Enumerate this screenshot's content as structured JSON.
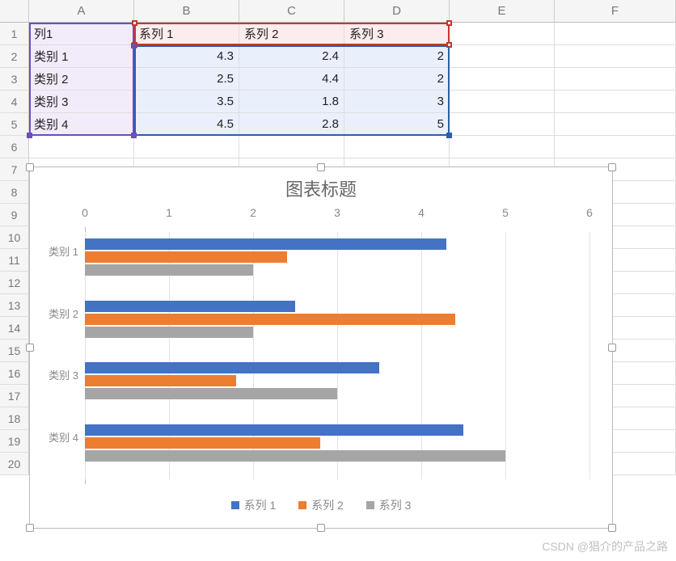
{
  "columns": [
    "A",
    "B",
    "C",
    "D",
    "E",
    "F"
  ],
  "row_numbers": [
    "1",
    "2",
    "3",
    "4",
    "5",
    "6",
    "7",
    "8",
    "9",
    "10",
    "11",
    "12",
    "13",
    "14",
    "15",
    "16",
    "17",
    "18",
    "19",
    "20"
  ],
  "table": {
    "corner_label": "列1",
    "series_headers": [
      "系列 1",
      "系列 2",
      "系列 3"
    ],
    "category_labels": [
      "类别 1",
      "类别 2",
      "类别 3",
      "类别 4"
    ],
    "values": [
      [
        "4.3",
        "2.4",
        "2"
      ],
      [
        "2.5",
        "4.4",
        "2"
      ],
      [
        "3.5",
        "1.8",
        "3"
      ],
      [
        "4.5",
        "2.8",
        "5"
      ]
    ]
  },
  "chart_data": {
    "type": "bar",
    "orientation": "horizontal",
    "title": "图表标题",
    "categories": [
      "类别 1",
      "类别 2",
      "类别 3",
      "类别 4"
    ],
    "series": [
      {
        "name": "系列 1",
        "values": [
          4.3,
          2.5,
          3.5,
          4.5
        ],
        "color": "#4472c4"
      },
      {
        "name": "系列 2",
        "values": [
          2.4,
          4.4,
          1.8,
          2.8
        ],
        "color": "#ed7d31"
      },
      {
        "name": "系列 3",
        "values": [
          2,
          2,
          3,
          5
        ],
        "color": "#a5a5a5"
      }
    ],
    "xlabel": "",
    "ylabel": "",
    "xticks": [
      0,
      1,
      2,
      3,
      4,
      5,
      6
    ],
    "xlim": [
      0,
      6
    ],
    "legend_position": "bottom"
  },
  "watermark": "CSDN @猖介的产品之路"
}
